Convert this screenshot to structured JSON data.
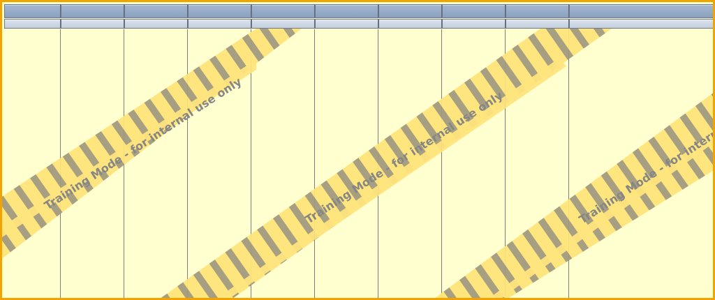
{
  "window": {
    "columns": 10,
    "header_rows": 2
  },
  "colors": {
    "frame_border": "#f1a400",
    "workspace_background": "#ffffcf",
    "header_primary": "#8aa0bd",
    "header_secondary": "#c3cedd",
    "tape_fill": "#ffe47a",
    "tape_stripe": "#7f7f7f"
  },
  "watermark": {
    "text": "Training Mode - for internal use only",
    "stripe_pattern": "diagonal-hazard"
  }
}
